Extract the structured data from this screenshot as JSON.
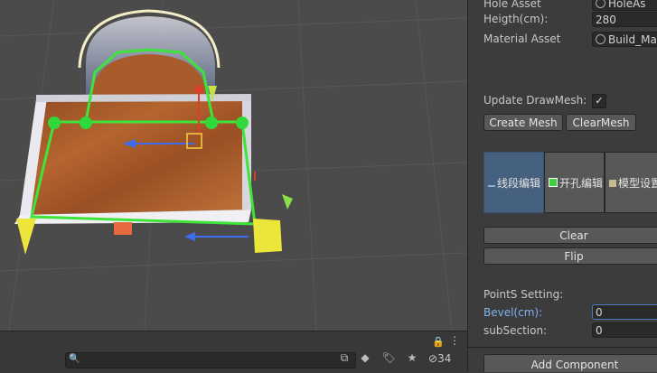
{
  "scene": {
    "search_placeholder": "",
    "visibility_count": "34"
  },
  "inspector": {
    "hole_asset_label": "Hole Asset",
    "hole_asset_value": "HoleAs",
    "height_label": "Heigth(cm):",
    "height_value": "280",
    "material_label": "Material Asset",
    "material_value": "Build_Ma",
    "update_label": "Update DrawMesh:",
    "update_checked": "✓",
    "create_mesh": "Create Mesh",
    "clear_mesh": "ClearMesh",
    "tabs": [
      {
        "label": "线段编辑"
      },
      {
        "label": "开孔编辑"
      },
      {
        "label": "模型设置"
      }
    ],
    "clear": "Clear",
    "flip": "Flip",
    "points_setting": "PointS Setting:",
    "bevel_label": "Bevel(cm):",
    "bevel_value": "0",
    "subsection_label": "subSection:",
    "subsection_value": "0",
    "add_component": "Add Component"
  }
}
